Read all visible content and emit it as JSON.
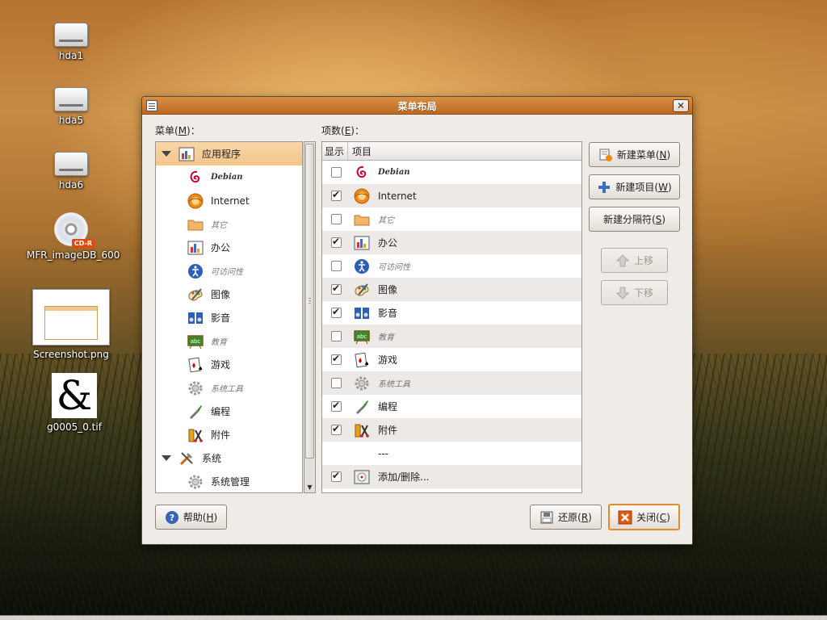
{
  "desktop": {
    "icons": [
      {
        "label": "hda1",
        "type": "drive"
      },
      {
        "label": "hda5",
        "type": "drive"
      },
      {
        "label": "hda6",
        "type": "drive"
      },
      {
        "label": "MFR_imageDB_600",
        "type": "cdrom",
        "badge": "CD-R"
      },
      {
        "label": "Screenshot.png",
        "type": "image"
      },
      {
        "label": "g0005_0.tif",
        "type": "tif",
        "glyph": "&"
      }
    ]
  },
  "dialog": {
    "title": "菜单布局",
    "close_glyph": "✕",
    "menus_label_prefix": "菜单(",
    "menus_label_key": "M",
    "menus_label_suffix": ")：",
    "items_label_prefix": "项数(",
    "items_label_key": "E",
    "items_label_suffix": ")：",
    "tree": [
      {
        "label": "应用程序",
        "level": 1,
        "expanded": true,
        "selected": true,
        "icon": "applications-icon"
      },
      {
        "label": "Debian",
        "level": 2,
        "style": "bold-italic",
        "icon": "debian-icon"
      },
      {
        "label": "Internet",
        "level": 2,
        "icon": "internet-icon"
      },
      {
        "label": "其它",
        "level": 2,
        "style": "dim",
        "icon": "folder-icon"
      },
      {
        "label": "办公",
        "level": 2,
        "icon": "office-icon"
      },
      {
        "label": "可访问性",
        "level": 2,
        "style": "dim",
        "icon": "accessibility-icon"
      },
      {
        "label": "图像",
        "level": 2,
        "icon": "graphics-icon"
      },
      {
        "label": "影音",
        "level": 2,
        "icon": "multimedia-icon"
      },
      {
        "label": "教育",
        "level": 2,
        "style": "dim",
        "icon": "education-icon"
      },
      {
        "label": "游戏",
        "level": 2,
        "icon": "games-icon"
      },
      {
        "label": "系统工具",
        "level": 2,
        "style": "dim",
        "icon": "system-tools-icon"
      },
      {
        "label": "编程",
        "level": 2,
        "icon": "programming-icon"
      },
      {
        "label": "附件",
        "level": 2,
        "icon": "accessories-icon"
      },
      {
        "label": "系统",
        "level": 1,
        "expanded": true,
        "icon": "system-icon"
      },
      {
        "label": "系统管理",
        "level": 2,
        "icon": "administration-icon"
      }
    ],
    "items_header": {
      "show": "显示",
      "item": "项目"
    },
    "items": [
      {
        "label": "Debian",
        "checked": false,
        "style": "bold-italic",
        "icon": "debian-icon"
      },
      {
        "label": "Internet",
        "checked": true,
        "icon": "internet-icon"
      },
      {
        "label": "其它",
        "checked": false,
        "style": "dim",
        "icon": "folder-icon"
      },
      {
        "label": "办公",
        "checked": true,
        "icon": "office-icon"
      },
      {
        "label": "可访问性",
        "checked": false,
        "style": "dim",
        "icon": "accessibility-icon"
      },
      {
        "label": "图像",
        "checked": true,
        "icon": "graphics-icon"
      },
      {
        "label": "影音",
        "checked": true,
        "icon": "multimedia-icon"
      },
      {
        "label": "教育",
        "checked": false,
        "style": "dim",
        "icon": "education-icon"
      },
      {
        "label": "游戏",
        "checked": true,
        "icon": "games-icon"
      },
      {
        "label": "系统工具",
        "checked": false,
        "style": "dim",
        "icon": "system-tools-icon"
      },
      {
        "label": "编程",
        "checked": true,
        "icon": "programming-icon"
      },
      {
        "label": "附件",
        "checked": true,
        "icon": "accessories-icon"
      },
      {
        "label": "---",
        "checked": null,
        "icon": ""
      },
      {
        "label": "添加/删除...",
        "checked": true,
        "icon": "add-remove-icon"
      }
    ],
    "buttons": {
      "new_menu": {
        "label": "新建菜单(",
        "key": "N",
        "suffix": ")"
      },
      "new_item": {
        "label": "新建项目(",
        "key": "W",
        "suffix": ")"
      },
      "new_separator": {
        "label": "新建分隔符(",
        "key": "S",
        "suffix": ")"
      },
      "move_up": {
        "label": "上移"
      },
      "move_down": {
        "label": "下移"
      },
      "help": {
        "label": "帮助(",
        "key": "H",
        "suffix": ")"
      },
      "revert": {
        "label": "还原(",
        "key": "R",
        "suffix": ")"
      },
      "close": {
        "label": "关闭(",
        "key": "C",
        "suffix": ")"
      }
    },
    "colors": {
      "accent": "#e08a2e",
      "selection": "#f6cf9c",
      "titlebar": "#c97a30"
    }
  }
}
